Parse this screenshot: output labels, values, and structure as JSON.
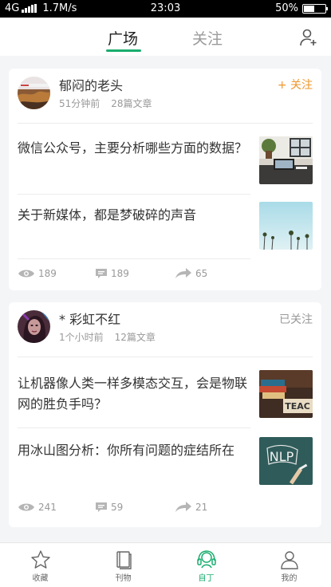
{
  "status_bar": {
    "network": "4G",
    "speed": "1.7M/s",
    "time": "23:03",
    "battery": "50%",
    "battery_level": 0.5
  },
  "header": {
    "tabs": [
      {
        "label": "广场",
        "active": true
      },
      {
        "label": "关注",
        "active": false
      }
    ]
  },
  "cards": [
    {
      "author": "郁闷的老头",
      "time_ago": "51分钟前",
      "article_count": "28篇文章",
      "follow_label": "+ 关注",
      "articles": [
        {
          "title": "微信公众号，主要分析哪些方面的数据？"
        },
        {
          "title": "关于新媒体，都是梦破碎的声音"
        }
      ],
      "stats": {
        "views": "189",
        "comments": "189",
        "shares": "65"
      }
    },
    {
      "author": "* 彩虹不红",
      "time_ago": "1个小时前",
      "article_count": "12篇文章",
      "follow_label": "已关注",
      "articles": [
        {
          "title": "让机器像人类一样多模态交互，会是物联网的胜负手吗？",
          "thumb_text": "TEAC"
        },
        {
          "title": "用冰山图分析：你所有问题的症结所在",
          "thumb_text": "NLP"
        }
      ],
      "stats": {
        "views": "241",
        "comments": "59",
        "shares": "21"
      }
    }
  ],
  "bottom_nav": [
    {
      "label": "收藏",
      "icon": "star-icon",
      "active": false
    },
    {
      "label": "刊物",
      "icon": "journal-icon",
      "active": false
    },
    {
      "label": "自丁",
      "icon": "headset-icon",
      "active": true
    },
    {
      "label": "我的",
      "icon": "user-icon",
      "active": false
    }
  ],
  "colors": {
    "accent": "#1aad6e",
    "follow": "#f0962b",
    "muted": "#999999"
  }
}
